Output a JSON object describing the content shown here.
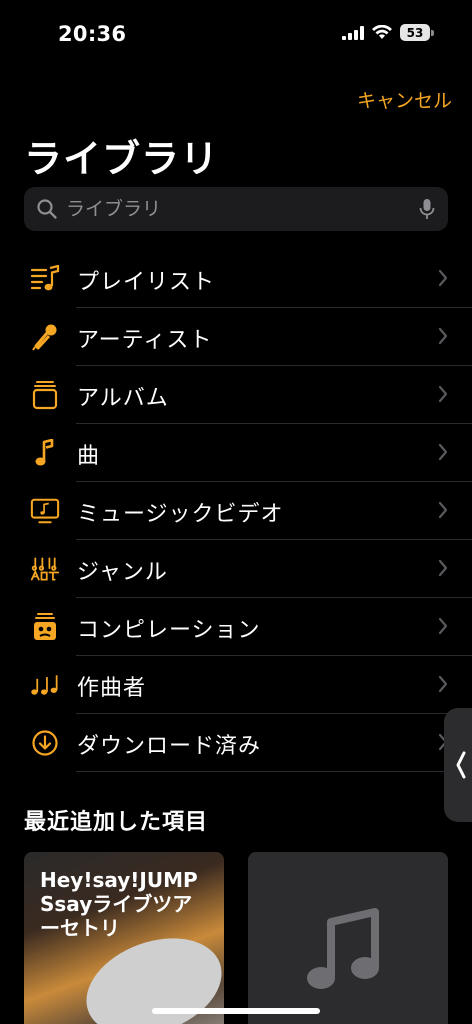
{
  "status_bar": {
    "time": "20:36",
    "battery": "53"
  },
  "header": {
    "cancel_label": "キャンセル",
    "title": "ライブラリ"
  },
  "search": {
    "placeholder": "ライブラリ"
  },
  "library_items": [
    {
      "label": "プレイリスト",
      "icon": "playlist-icon"
    },
    {
      "label": "アーティスト",
      "icon": "microphone-icon"
    },
    {
      "label": "アルバム",
      "icon": "album-icon"
    },
    {
      "label": "曲",
      "icon": "music-note-icon"
    },
    {
      "label": "ミュージックビデオ",
      "icon": "music-video-icon"
    },
    {
      "label": "ジャンル",
      "icon": "genre-icon"
    },
    {
      "label": "コンピレーション",
      "icon": "compilation-icon"
    },
    {
      "label": "作曲者",
      "icon": "composer-icon"
    },
    {
      "label": "ダウンロード済み",
      "icon": "download-icon"
    }
  ],
  "recent": {
    "title": "最近追加した項目",
    "items": [
      {
        "title": "Hey!say!JUMP Ssayライブツアーセトリ"
      },
      {
        "title": ""
      }
    ]
  },
  "colors": {
    "accent": "#f5a623",
    "background": "#000000",
    "search_bg": "#1c1c1e"
  }
}
